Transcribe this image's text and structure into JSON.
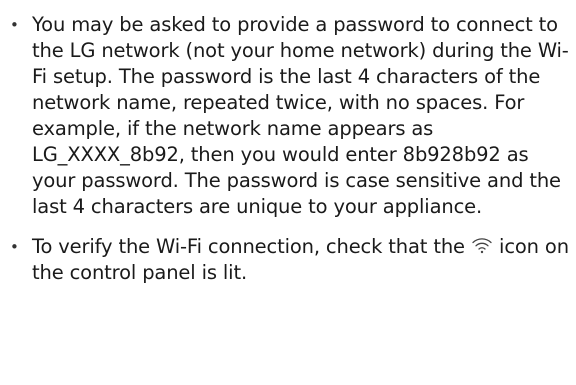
{
  "bullets": [
    {
      "text": "You may be asked to provide a password to connect to the LG network (not your home network) during the Wi-Fi setup. The password is the last 4 characters of the network name, repeated twice, with no spaces. For example, if the network name appears as LG_XXXX_8b92, then you would enter 8b928b92 as your password. The password is case sensitive and the last 4 characters are unique to your appliance."
    },
    {
      "text_before_icon": "To verify the Wi-Fi connection, check that the",
      "icon": "wifi-icon",
      "text_after_icon": "icon on the control panel is lit."
    }
  ]
}
